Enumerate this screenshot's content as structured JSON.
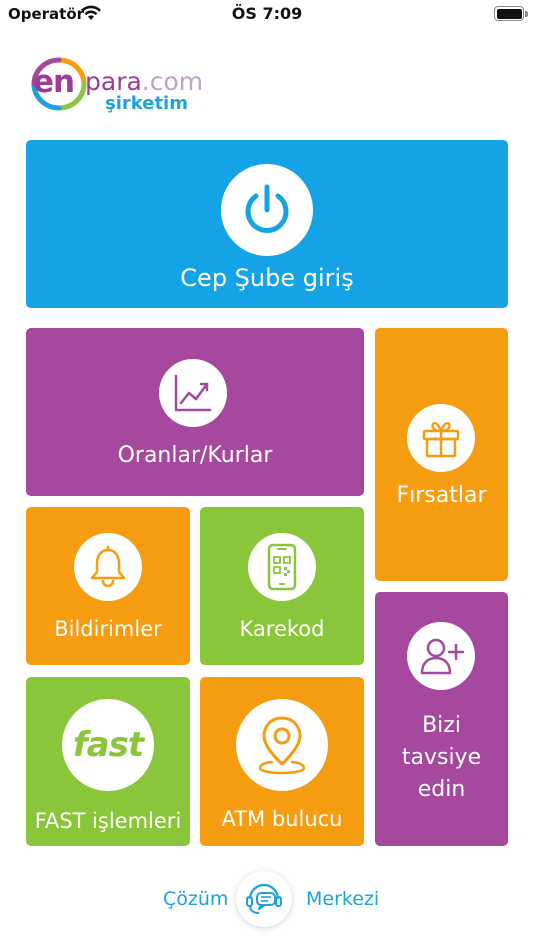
{
  "status_bar": {
    "carrier": "Operatör",
    "time": "ÖS 7:09"
  },
  "logo": {
    "brand_en": "en",
    "brand_para": "para",
    "brand_com": ".com",
    "brand_sirketim": "şirketim"
  },
  "tiles": {
    "cep_sube": {
      "label": "Cep Şube giriş",
      "icon": "power-icon",
      "color": "#13a3e6"
    },
    "oranlar": {
      "label": "Oranlar/Kurlar",
      "icon": "chart-line-icon",
      "color": "#a6489d"
    },
    "firsatlar": {
      "label": "Fırsatlar",
      "icon": "gift-icon",
      "color": "#f69c11"
    },
    "bildirimler": {
      "label": "Bildirimler",
      "icon": "bell-icon",
      "color": "#f69c11"
    },
    "karekod": {
      "label": "Karekod",
      "icon": "phone-qr-icon",
      "color": "#8ac63a"
    },
    "tavsiye": {
      "label_line1": "Bizi",
      "label_line2": "tavsiye",
      "label_line3": "edin",
      "icon": "add-user-icon",
      "color": "#a6489d"
    },
    "fast": {
      "label": "FAST işlemleri",
      "icon_text": "fast",
      "color": "#8ac63a"
    },
    "atm": {
      "label": "ATM bulucu",
      "icon": "location-pin-icon",
      "color": "#f69c11"
    }
  },
  "solution_center": {
    "left_text": "Çözüm",
    "right_text": "Merkezi",
    "icon": "headset-chat-icon",
    "color": "#1da2e0"
  }
}
